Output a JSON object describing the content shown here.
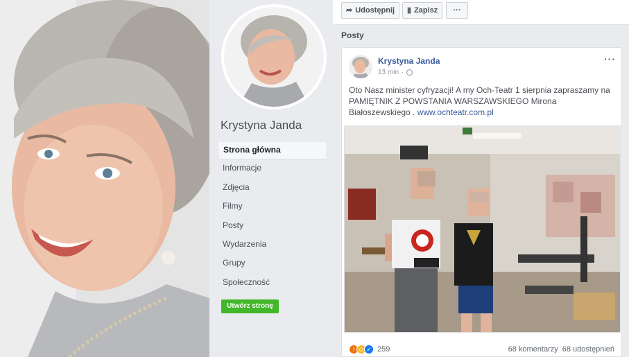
{
  "colors": {
    "link": "#365899",
    "create_button": "#42b72a",
    "background": "#e9ebee"
  },
  "profile": {
    "page_name": "Krystyna Janda",
    "nav_items": [
      {
        "label": "Strona główna",
        "active": true
      },
      {
        "label": "Informacje"
      },
      {
        "label": "Zdjęcia"
      },
      {
        "label": "Filmy"
      },
      {
        "label": "Posty"
      },
      {
        "label": "Wydarzenia"
      },
      {
        "label": "Grupy"
      },
      {
        "label": "Społeczność"
      }
    ],
    "create_page_label": "Utwórz stronę"
  },
  "action_bar": {
    "share_label": "Udostępnij",
    "share_icon": "share-arrow-icon",
    "save_label": "Zapisz",
    "save_icon": "bookmark-icon",
    "more_label": "···"
  },
  "posts_section": {
    "title": "Posty"
  },
  "post": {
    "author": "Krystyna Janda",
    "time": "13 min",
    "privacy_icon": "globe-icon",
    "text_main": "Oto Nasz minister cyfryzacji! A my Och-Teatr 1 sierpnia zapraszamy na PAMIĘTNIK Z POWSTANIA WARSZAWSKIEGO Mirona Białoszewskiego . ",
    "link_text": "www.ochteatr.com.pl",
    "more_label": "···",
    "reaction_count": "259",
    "comments": "68 komentarzy",
    "shares": "68 udostępnień"
  }
}
